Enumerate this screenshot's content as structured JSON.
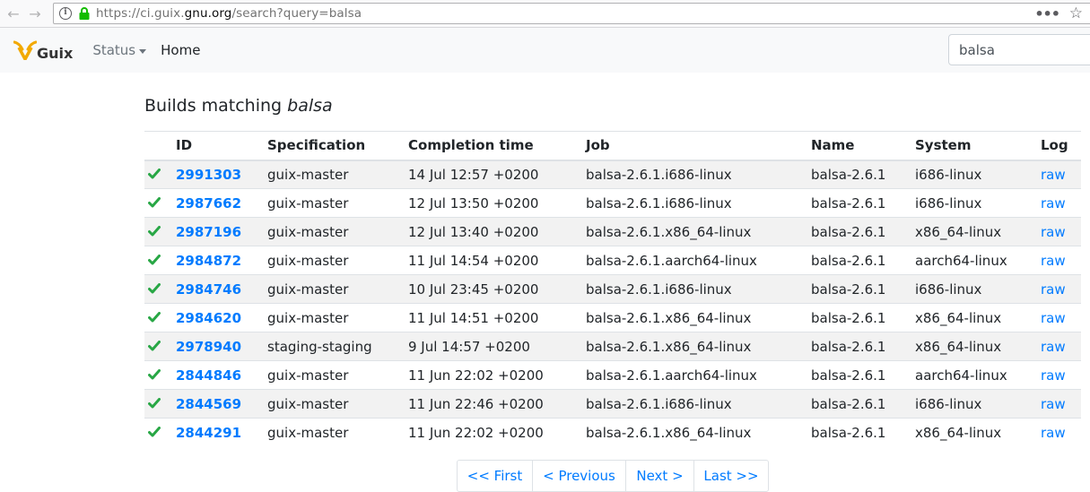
{
  "browser": {
    "url_prefix": "https://ci.guix.",
    "url_host": "gnu.org",
    "url_suffix": "/search?query=balsa",
    "back": "←",
    "forward": "→",
    "more": "•••",
    "star": "☆"
  },
  "navbar": {
    "brand": "Guix",
    "status_label": "Status",
    "home_label": "Home",
    "search_value": "balsa"
  },
  "page": {
    "title_prefix": "Builds matching ",
    "title_query": "balsa"
  },
  "table": {
    "headers": {
      "id": "ID",
      "specification": "Specification",
      "completion": "Completion time",
      "job": "Job",
      "name": "Name",
      "system": "System",
      "log": "Log"
    },
    "rows": [
      {
        "id": "2991303",
        "spec": "guix-master",
        "time": "14 Jul 12:57 +0200",
        "job": "balsa-2.6.1.i686-linux",
        "name": "balsa-2.6.1",
        "system": "i686-linux",
        "log": "raw"
      },
      {
        "id": "2987662",
        "spec": "guix-master",
        "time": "12 Jul 13:50 +0200",
        "job": "balsa-2.6.1.i686-linux",
        "name": "balsa-2.6.1",
        "system": "i686-linux",
        "log": "raw"
      },
      {
        "id": "2987196",
        "spec": "guix-master",
        "time": "12 Jul 13:40 +0200",
        "job": "balsa-2.6.1.x86_64-linux",
        "name": "balsa-2.6.1",
        "system": "x86_64-linux",
        "log": "raw"
      },
      {
        "id": "2984872",
        "spec": "guix-master",
        "time": "11 Jul 14:54 +0200",
        "job": "balsa-2.6.1.aarch64-linux",
        "name": "balsa-2.6.1",
        "system": "aarch64-linux",
        "log": "raw"
      },
      {
        "id": "2984746",
        "spec": "guix-master",
        "time": "10 Jul 23:45 +0200",
        "job": "balsa-2.6.1.i686-linux",
        "name": "balsa-2.6.1",
        "system": "i686-linux",
        "log": "raw"
      },
      {
        "id": "2984620",
        "spec": "guix-master",
        "time": "11 Jul 14:51 +0200",
        "job": "balsa-2.6.1.x86_64-linux",
        "name": "balsa-2.6.1",
        "system": "x86_64-linux",
        "log": "raw"
      },
      {
        "id": "2978940",
        "spec": "staging-staging",
        "time": "9 Jul 14:57 +0200",
        "job": "balsa-2.6.1.x86_64-linux",
        "name": "balsa-2.6.1",
        "system": "x86_64-linux",
        "log": "raw"
      },
      {
        "id": "2844846",
        "spec": "guix-master",
        "time": "11 Jun 22:02 +0200",
        "job": "balsa-2.6.1.aarch64-linux",
        "name": "balsa-2.6.1",
        "system": "aarch64-linux",
        "log": "raw"
      },
      {
        "id": "2844569",
        "spec": "guix-master",
        "time": "11 Jun 22:46 +0200",
        "job": "balsa-2.6.1.i686-linux",
        "name": "balsa-2.6.1",
        "system": "i686-linux",
        "log": "raw"
      },
      {
        "id": "2844291",
        "spec": "guix-master",
        "time": "11 Jun 22:02 +0200",
        "job": "balsa-2.6.1.x86_64-linux",
        "name": "balsa-2.6.1",
        "system": "x86_64-linux",
        "log": "raw"
      }
    ]
  },
  "pagination": {
    "first": "<< First",
    "previous": "< Previous",
    "next": "Next >",
    "last": "Last >>"
  },
  "colors": {
    "link": "#007bff",
    "success": "#28a745",
    "brand_orange": "#f2a900"
  }
}
